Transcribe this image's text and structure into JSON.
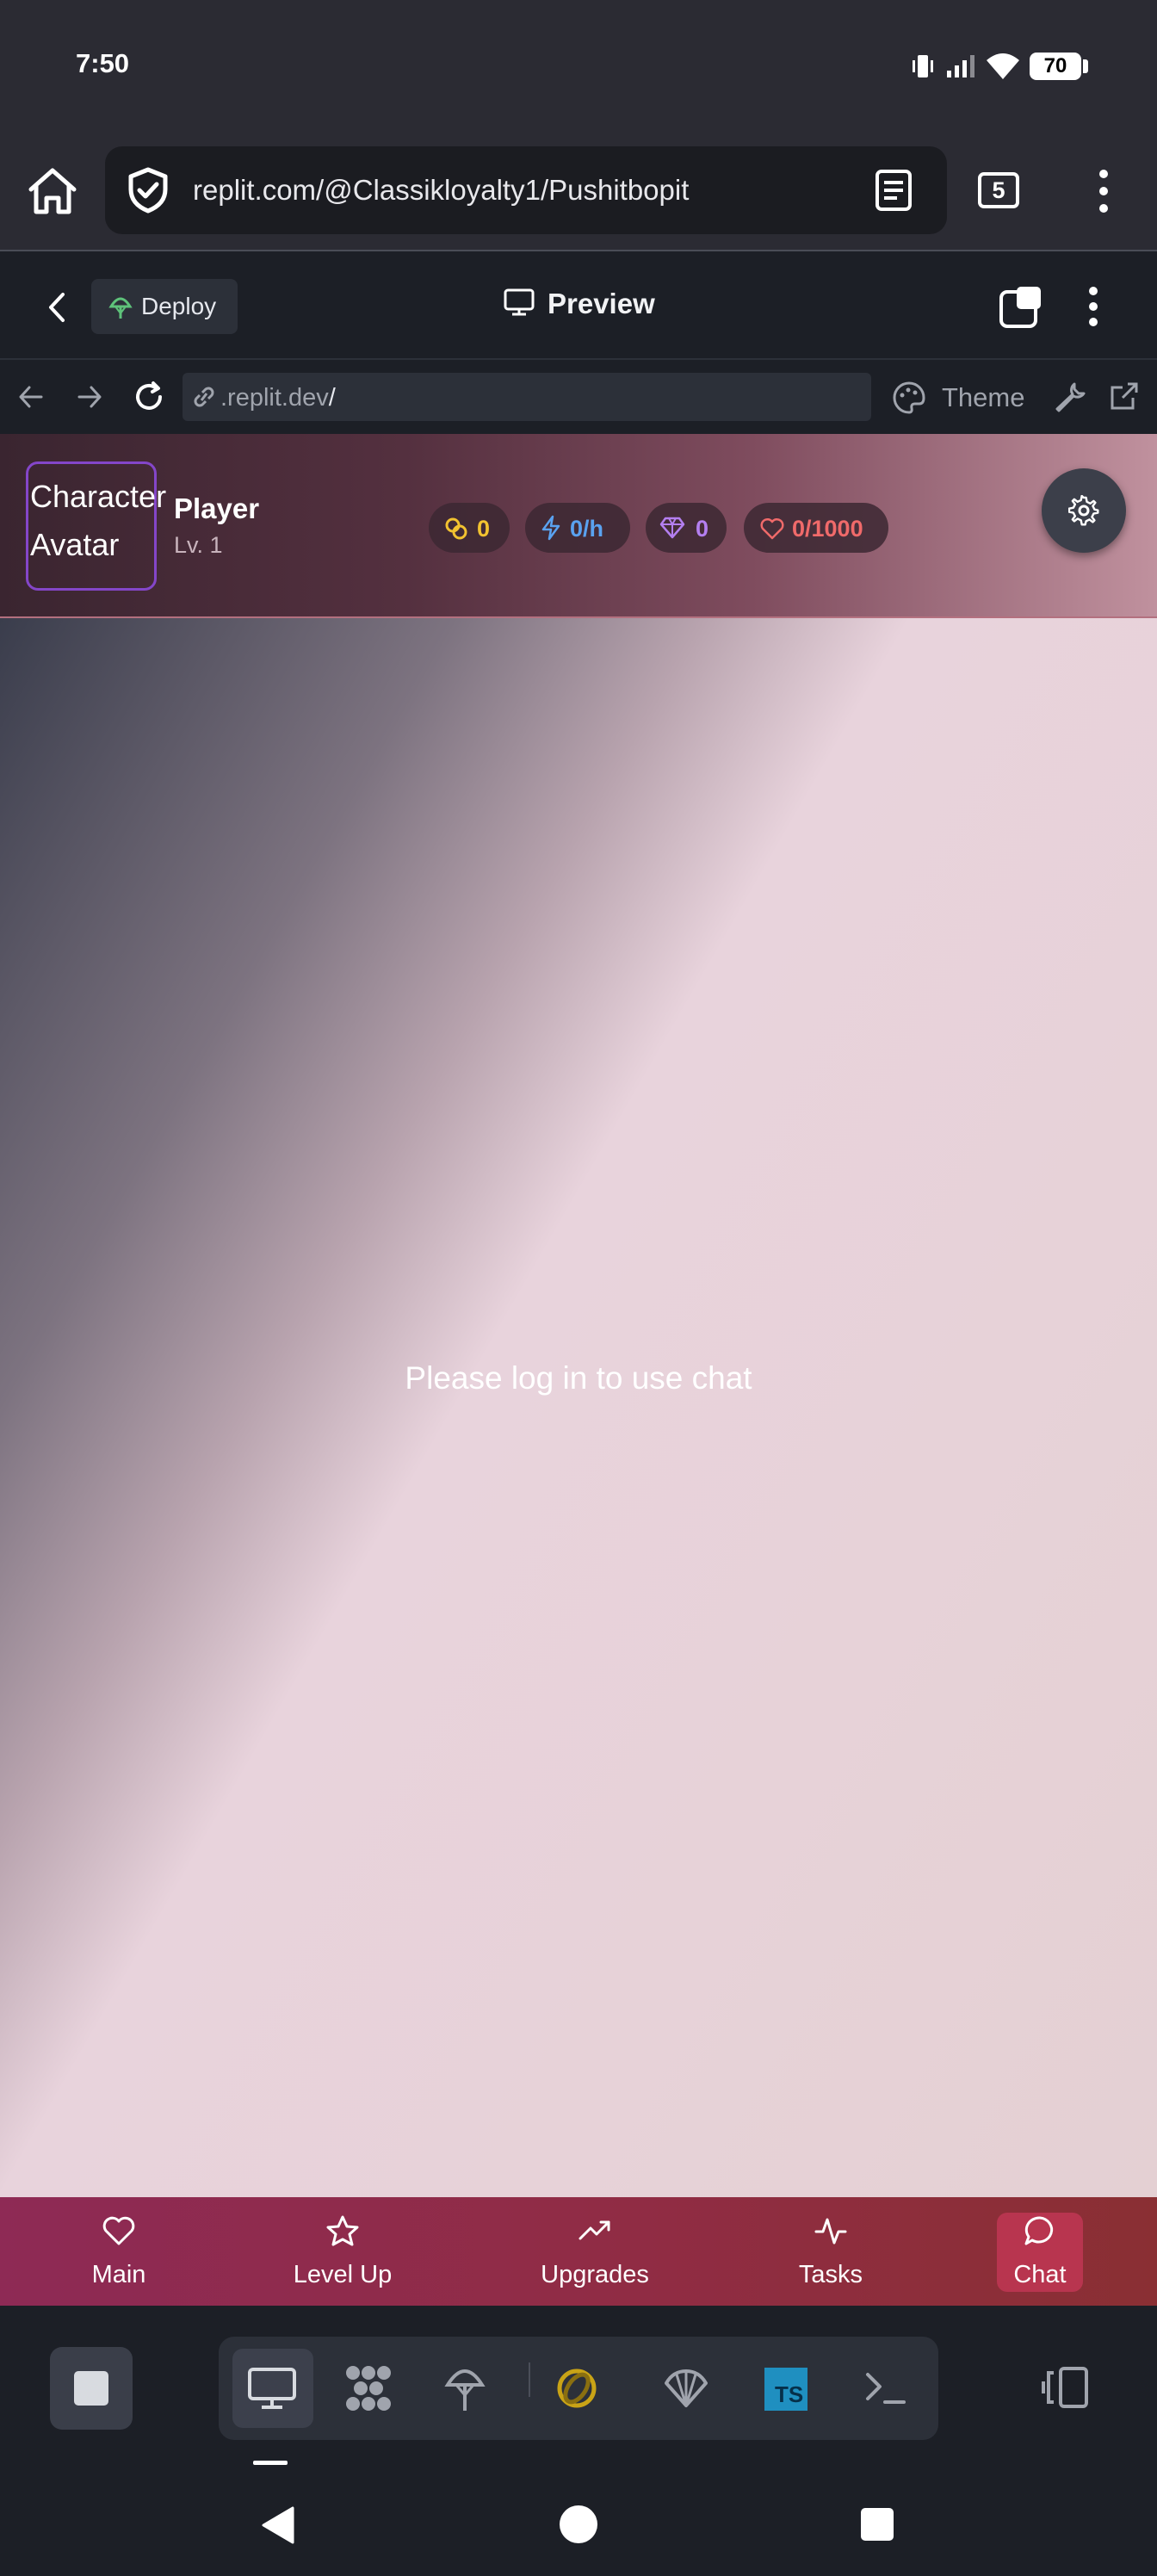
{
  "status_bar": {
    "time": "7:50",
    "battery": "70",
    "icons": [
      "vibrate-icon",
      "signal-icon",
      "wifi-icon",
      "battery-icon"
    ]
  },
  "browser": {
    "url": "replit.com/@Classikloyalty1/Pushitbopit",
    "tab_count": "5",
    "icons": [
      "home-icon",
      "shield-check-icon",
      "reader-mode-icon",
      "more-vert-icon"
    ]
  },
  "replit_header": {
    "deploy_label": "Deploy",
    "preview_title": "Preview"
  },
  "webview_bar": {
    "address_prefix": ".replit.dev",
    "address_suffix": "/",
    "theme_label": "Theme"
  },
  "app_header": {
    "avatar_text": "Character Avatar",
    "avatar_line1": "Character",
    "avatar_line2": "Avatar",
    "player_name": "Player",
    "player_level": "Lv. 1",
    "stats": {
      "coins": "0",
      "energy": "0/h",
      "gems": "0",
      "health": "0/1000"
    },
    "colors": {
      "coins": "#f2c230",
      "energy": "#5aa2f0",
      "gems": "#b47ff0",
      "health": "#f06a6a"
    }
  },
  "main": {
    "message": "Please log in to use chat"
  },
  "app_nav": {
    "items": [
      {
        "label": "Main",
        "icon": "heart-icon"
      },
      {
        "label": "Level Up",
        "icon": "star-icon"
      },
      {
        "label": "Upgrades",
        "icon": "trending-up-icon"
      },
      {
        "label": "Tasks",
        "icon": "activity-icon"
      },
      {
        "label": "Chat",
        "icon": "message-circle-icon"
      }
    ],
    "active": "Chat"
  },
  "tool_bar": {
    "tools": [
      "preview-icon",
      "packages-icon",
      "deployments-icon",
      "python-icon",
      "gem-icon",
      "typescript-icon",
      "shell-icon"
    ],
    "typescript_label": "TS"
  }
}
